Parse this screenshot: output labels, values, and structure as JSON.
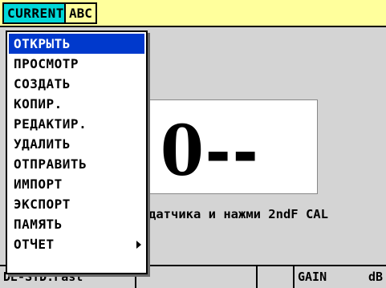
{
  "header": {
    "mode_label": "CURRENT",
    "file_name": "ABC"
  },
  "display": {
    "reading": "0--",
    "message": "датчика и нажми 2ndF CAL"
  },
  "status_bar": {
    "setup_name": "DE-STD.Fast",
    "gain_label": "GAIN",
    "gain_unit": "dB"
  },
  "menu": {
    "items": [
      {
        "label": "ОТКРЫТЬ",
        "selected": true,
        "has_submenu": false
      },
      {
        "label": "ПРОСМОТР",
        "selected": false,
        "has_submenu": false
      },
      {
        "label": "СОЗДАТЬ",
        "selected": false,
        "has_submenu": false
      },
      {
        "label": "КОПИР.",
        "selected": false,
        "has_submenu": false
      },
      {
        "label": "РЕДАКТИР.",
        "selected": false,
        "has_submenu": false
      },
      {
        "label": "УДАЛИТЬ",
        "selected": false,
        "has_submenu": false
      },
      {
        "label": "ОТПРАВИТЬ",
        "selected": false,
        "has_submenu": false
      },
      {
        "label": "ИМПОРТ",
        "selected": false,
        "has_submenu": false
      },
      {
        "label": "ЭКСПОРТ",
        "selected": false,
        "has_submenu": false
      },
      {
        "label": "ПАМЯТЬ",
        "selected": false,
        "has_submenu": false
      },
      {
        "label": "ОТЧЕТ",
        "selected": false,
        "has_submenu": true
      }
    ]
  },
  "colors": {
    "title_bar": "#ffff9c",
    "mode_tag": "#00d8d8",
    "menu_highlight": "#0039cc",
    "background": "#d4d4d4"
  }
}
